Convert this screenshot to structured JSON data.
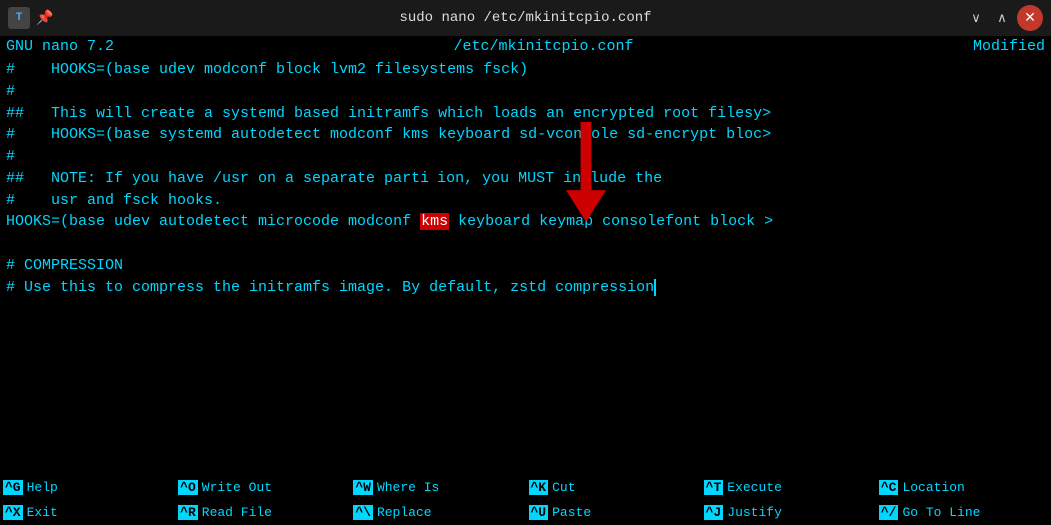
{
  "titlebar": {
    "title": "sudo nano /etc/mkinitcpio.conf",
    "icon_label": "T",
    "pin_char": "📌",
    "minimize_char": "∨",
    "maximize_char": "∧",
    "close_char": "✕"
  },
  "statusbar": {
    "left": "GNU nano 7.2",
    "center": "/etc/mkinitcpio.conf",
    "right": "Modified"
  },
  "editor": {
    "lines": [
      "#    HOOKS=(base udev modconf block lvm2 filesystems fsck)",
      "#",
      "##   This will create a systemd based initramfs which loads an encrypted root filesy>",
      "#    HOOKS=(base systemd autodetect modconf kms keyboard sd-vconsole sd-encrypt bloc>",
      "#",
      "##   NOTE: If you have /usr on a separate partition, you MUST include the",
      "#    usr and fsck hooks.",
      "HOOKS=(base udev autodetect microcode modconf [[KMS]] keyboard keymap consolefont block >",
      "",
      "# COMPRESSION",
      "# Use this to compress the initramfs image. By default, zstd compression▌"
    ]
  },
  "shortcuts": [
    {
      "key": "^G",
      "label": "Help"
    },
    {
      "key": "^O",
      "label": "Write Out"
    },
    {
      "key": "^W",
      "label": "Where Is"
    },
    {
      "key": "^K",
      "label": "Cut"
    },
    {
      "key": "^T",
      "label": "Execute"
    },
    {
      "key": "^C",
      "label": "Location"
    },
    {
      "key": "^X",
      "label": "Exit"
    },
    {
      "key": "^R",
      "label": "Read File"
    },
    {
      "key": "^\\",
      "label": "Replace"
    },
    {
      "key": "^U",
      "label": "Paste"
    },
    {
      "key": "^J",
      "label": "Justify"
    },
    {
      "key": "^/",
      "label": "Go To Line"
    }
  ]
}
